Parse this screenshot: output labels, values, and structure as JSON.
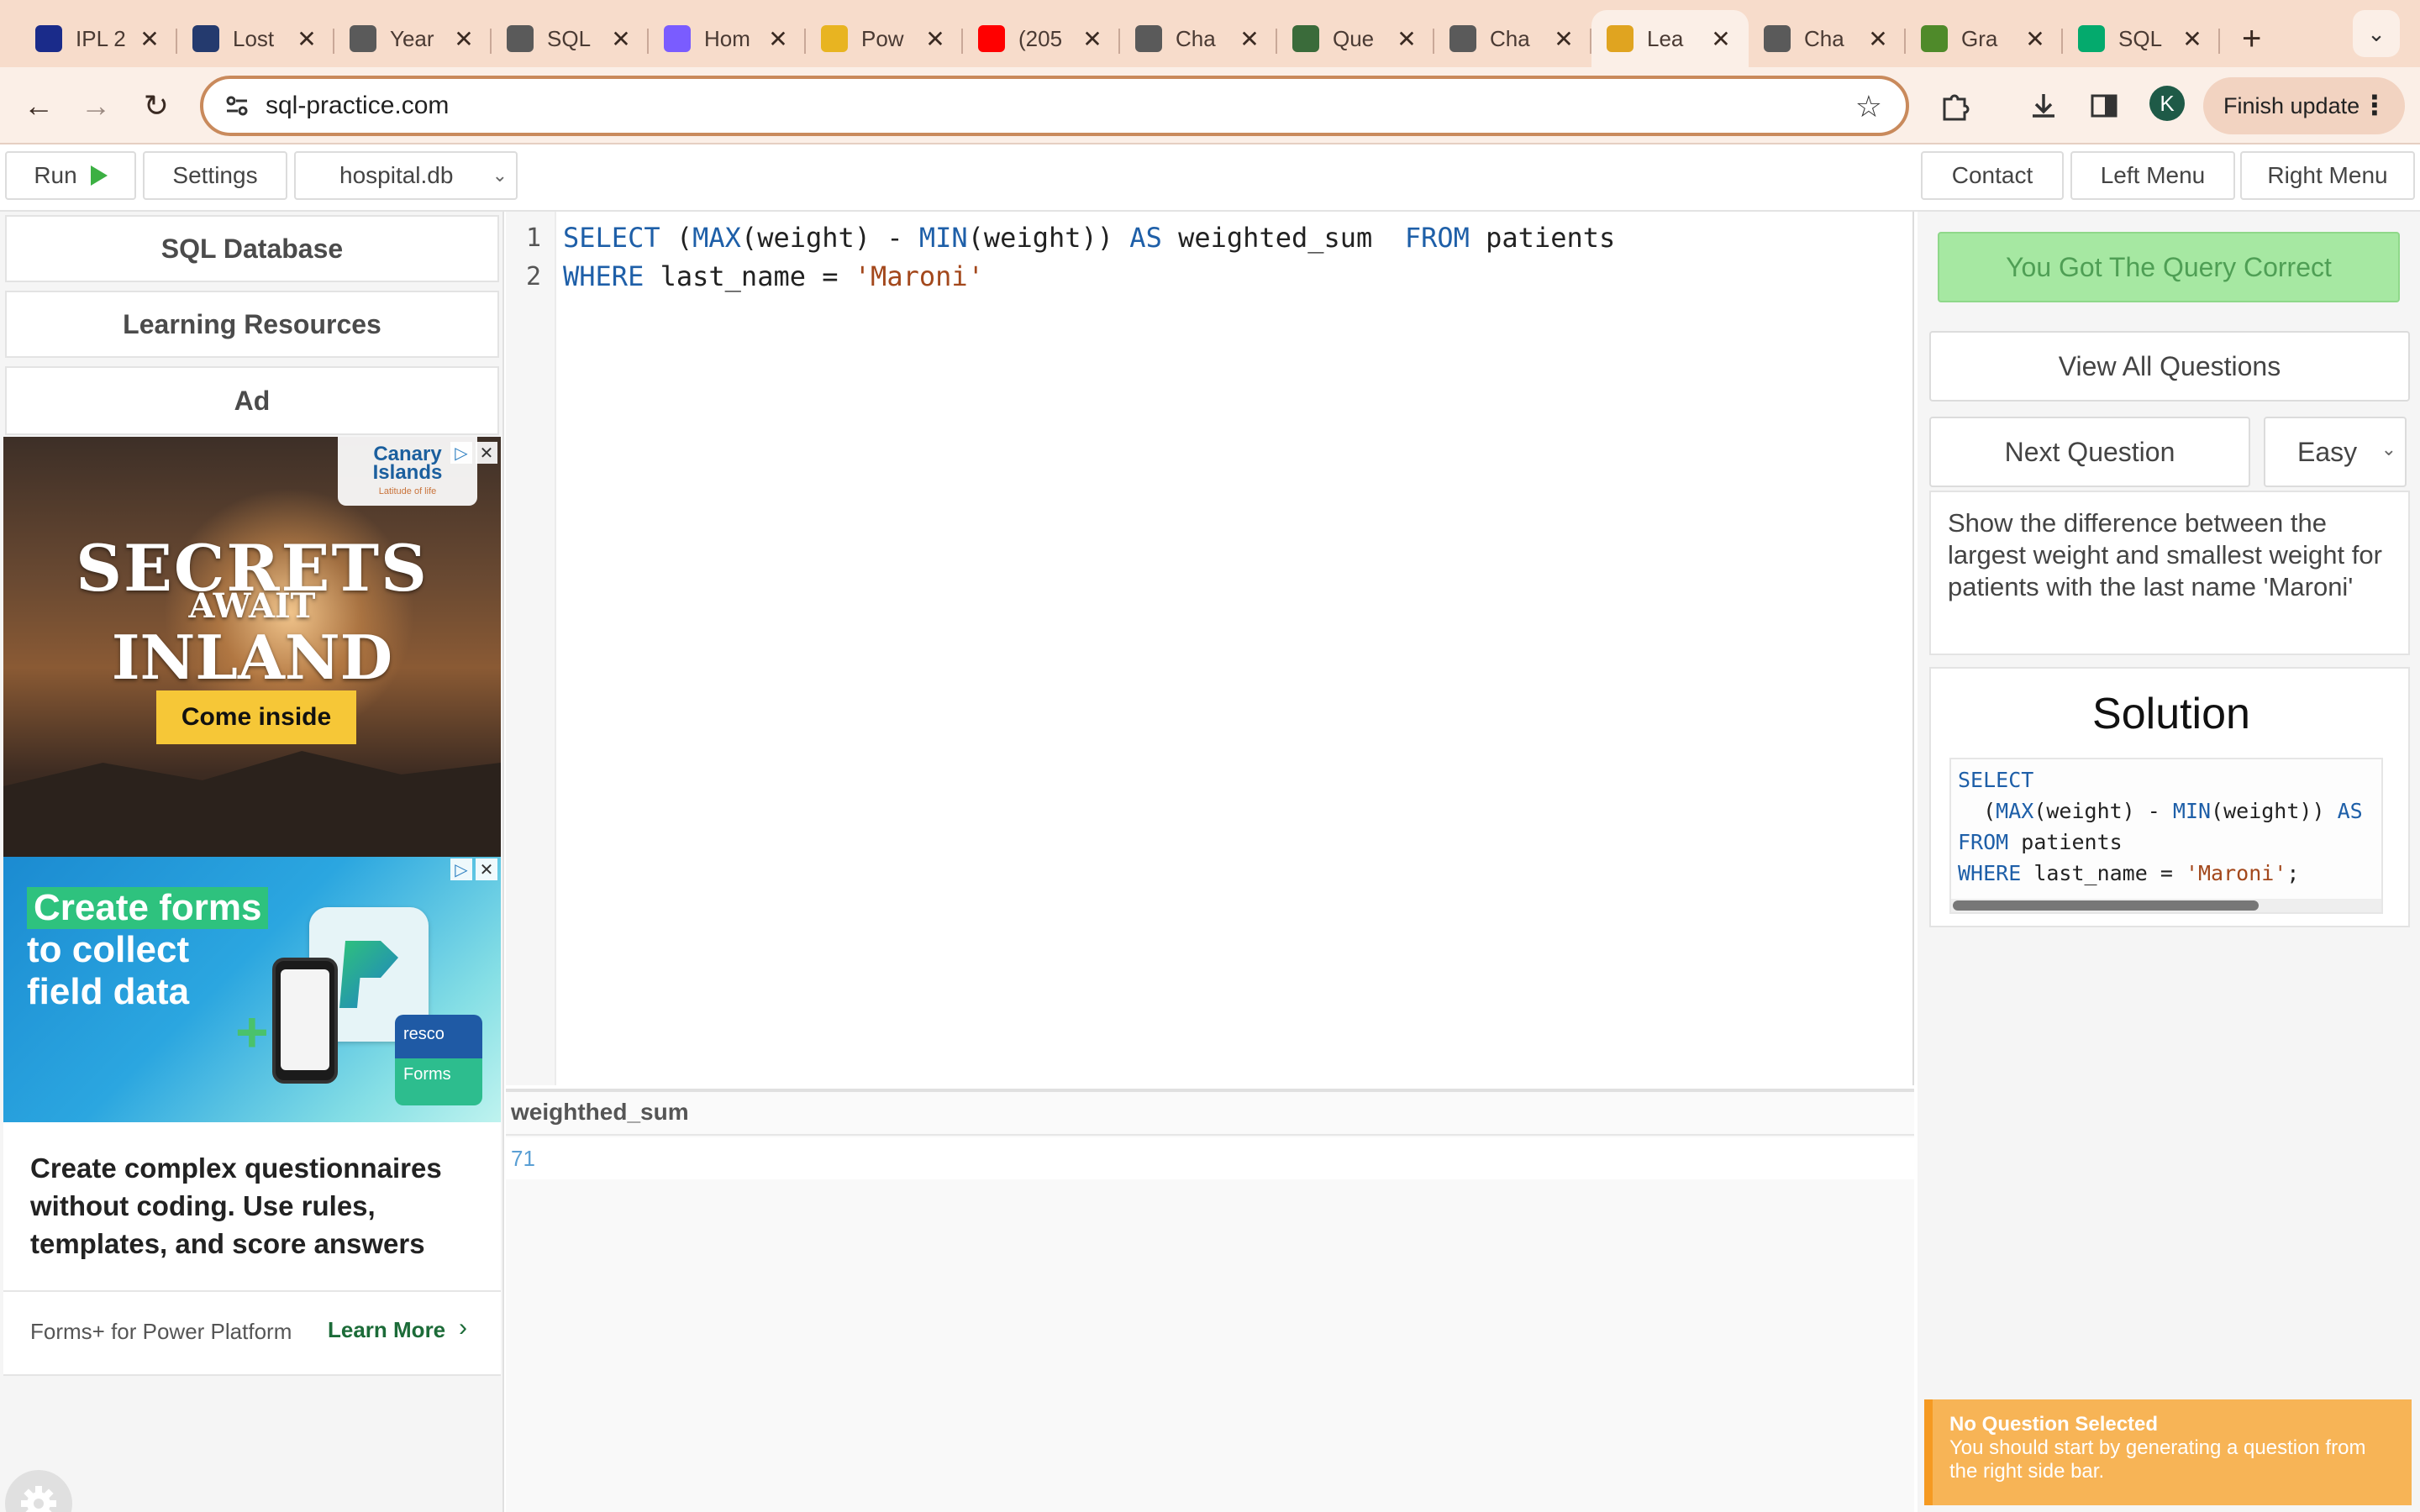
{
  "browser": {
    "tabs": [
      {
        "title": "IPL 2",
        "favicon": "ipl-logo-icon",
        "color": "#1a2b8a"
      },
      {
        "title": "Lost",
        "favicon": "image-thumbnail-icon",
        "color": "#243a6e"
      },
      {
        "title": "Year",
        "favicon": "openai-icon",
        "color": "#5a5a5a"
      },
      {
        "title": "SQL",
        "favicon": "openai-icon",
        "color": "#5a5a5a"
      },
      {
        "title": "Hom",
        "favicon": "copilot-icon",
        "color": "#7a5cff"
      },
      {
        "title": "Pow",
        "favicon": "powerbi-icon",
        "color": "#e8b421"
      },
      {
        "title": "(205",
        "favicon": "youtube-icon",
        "color": "#ff0000"
      },
      {
        "title": "Cha",
        "favicon": "openai-icon",
        "color": "#5a5a5a"
      },
      {
        "title": "Que",
        "favicon": "link-icon",
        "color": "#3a6b3a"
      },
      {
        "title": "Cha",
        "favicon": "openai-icon",
        "color": "#5a5a5a"
      },
      {
        "title": "Lea",
        "favicon": "key-icon",
        "color": "#e0a420",
        "active": true
      },
      {
        "title": "Cha",
        "favicon": "openai-icon",
        "color": "#5a5a5a"
      },
      {
        "title": "Gra",
        "favicon": "leaf-icon",
        "color": "#4f8a2a"
      },
      {
        "title": "SQL",
        "favicon": "w3schools-icon",
        "color": "#04aa6d"
      }
    ],
    "new_tab": "+",
    "url": "sql-practice.com",
    "profile_initial": "K",
    "finish_update_label": "Finish update"
  },
  "toolbar": {
    "run_label": "Run",
    "settings_label": "Settings",
    "database_selected": "hospital.db",
    "contact_label": "Contact",
    "left_menu_label": "Left Menu",
    "right_menu_label": "Right Menu"
  },
  "left_panel": {
    "sql_database_label": "SQL Database",
    "learning_resources_label": "Learning Resources",
    "ad_label": "Ad",
    "ad1": {
      "brand_line1": "Canary",
      "brand_line2": "Islands",
      "brand_tagline": "Latitude of life",
      "headline1": "SECRETS",
      "headline2": "AWAIT",
      "headline3": "INLAND",
      "cta": "Come inside"
    },
    "ad2": {
      "line1": "Create forms",
      "line2": "to collect",
      "line3": "field data",
      "brand_top": "resco",
      "brand_bottom": "Forms"
    },
    "ad3": {
      "description": "Create complex questionnaires without coding. Use rules, templates, and score answers",
      "advertiser": "Forms+ for Power Platform",
      "learn_more": "Learn More"
    }
  },
  "editor": {
    "line_numbers": [
      "1",
      "2"
    ],
    "lines": [
      [
        {
          "t": "SELECT",
          "c": "kw"
        },
        {
          "t": " (",
          "c": ""
        },
        {
          "t": "MAX",
          "c": "kw"
        },
        {
          "t": "(weight) - ",
          "c": ""
        },
        {
          "t": "MIN",
          "c": "kw"
        },
        {
          "t": "(weight)) ",
          "c": ""
        },
        {
          "t": "AS",
          "c": "kw"
        },
        {
          "t": " weighted_sum  ",
          "c": ""
        },
        {
          "t": "FROM",
          "c": "kw"
        },
        {
          "t": " patients",
          "c": ""
        }
      ],
      [
        {
          "t": "WHERE",
          "c": "kw"
        },
        {
          "t": " last_name = ",
          "c": ""
        },
        {
          "t": "'Maroni'",
          "c": "str"
        }
      ]
    ]
  },
  "results": {
    "column": "weighthed_sum",
    "value": "71"
  },
  "right_panel": {
    "correct_label": "You Got The Query Correct",
    "view_all_label": "View All Questions",
    "next_question_label": "Next Question",
    "difficulty_selected": "Easy",
    "question_text": "Show the difference between the largest weight and smallest weight for patients with the last name 'Maroni'",
    "solution_title": "Solution",
    "solution_lines": [
      [
        {
          "t": "SELECT",
          "c": "kw"
        }
      ],
      [
        {
          "t": "  (",
          "c": ""
        },
        {
          "t": "MAX",
          "c": "kw"
        },
        {
          "t": "(weight) - ",
          "c": ""
        },
        {
          "t": "MIN",
          "c": "kw"
        },
        {
          "t": "(weight)) ",
          "c": ""
        },
        {
          "t": "AS",
          "c": "kw"
        }
      ],
      [
        {
          "t": "FROM",
          "c": "kw"
        },
        {
          "t": " patients",
          "c": ""
        }
      ],
      [
        {
          "t": "WHERE",
          "c": "kw"
        },
        {
          "t": " last_name = ",
          "c": ""
        },
        {
          "t": "'Maroni'",
          "c": "str"
        },
        {
          "t": ";",
          "c": ""
        }
      ]
    ]
  },
  "toast": {
    "title": "No Question Selected",
    "message": "You should start by generating a question from the right side bar."
  }
}
